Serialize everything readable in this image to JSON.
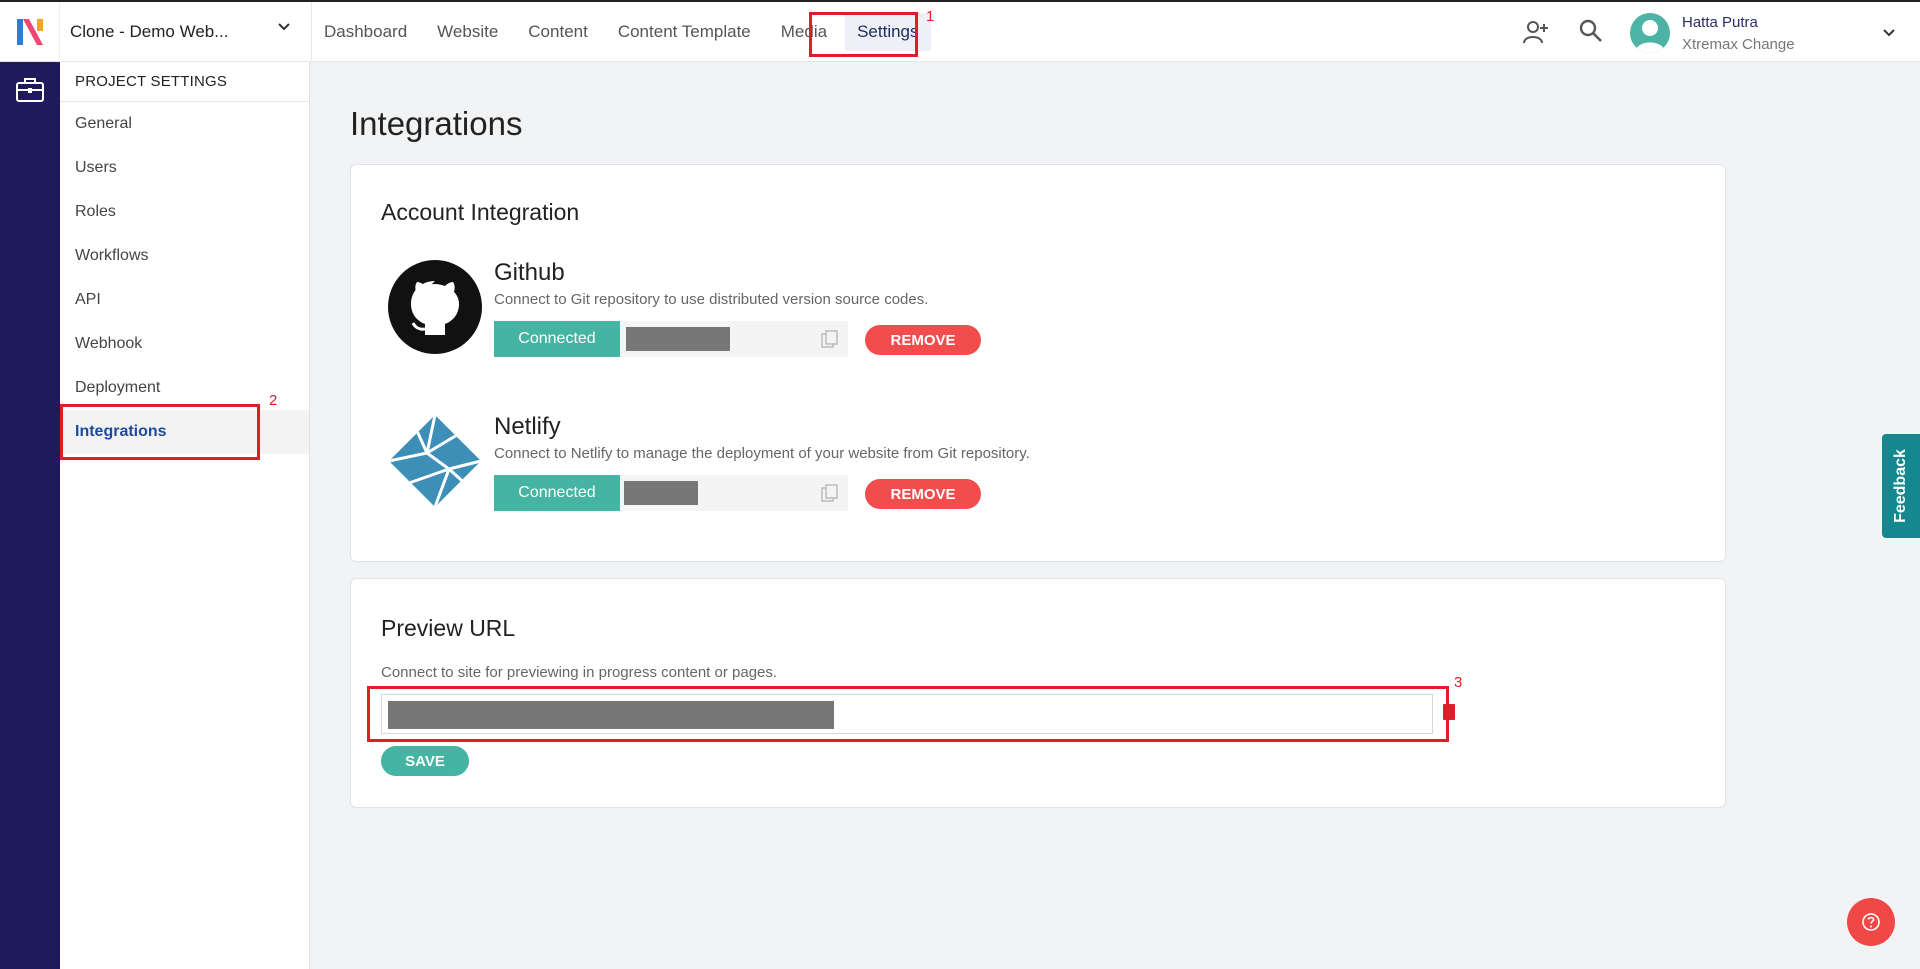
{
  "project": {
    "name": "Clone - Demo Web..."
  },
  "nav": {
    "items": [
      "Dashboard",
      "Website",
      "Content",
      "Content Template",
      "Media",
      "Settings"
    ]
  },
  "user": {
    "name": "Hatta Putra",
    "org": "Xtremax Change"
  },
  "sidebar": {
    "title": "PROJECT SETTINGS",
    "items": [
      "General",
      "Users",
      "Roles",
      "Workflows",
      "API",
      "Webhook",
      "Deployment",
      "Integrations"
    ],
    "active": "Integrations"
  },
  "page": {
    "title": "Integrations"
  },
  "account_integration": {
    "title": "Account Integration",
    "integrations": [
      {
        "name": "Github",
        "description": "Connect to Git repository to use distributed version source codes.",
        "status": "Connected",
        "remove_label": "REMOVE",
        "icon": "github-icon"
      },
      {
        "name": "Netlify",
        "description": "Connect to Netlify to manage the deployment of your website from Git repository.",
        "status": "Connected",
        "remove_label": "REMOVE",
        "icon": "netlify-icon"
      }
    ]
  },
  "preview_url": {
    "title": "Preview URL",
    "description": "Connect to site for previewing in progress content or pages.",
    "save_label": "SAVE"
  },
  "annotations": [
    "1",
    "2",
    "3"
  ],
  "feedback": {
    "label": "Feedback"
  },
  "colors": {
    "accent": "#46b4a2",
    "danger": "#f24c4c",
    "rail": "#1e1a5c",
    "highlight": "#e11d2a"
  }
}
